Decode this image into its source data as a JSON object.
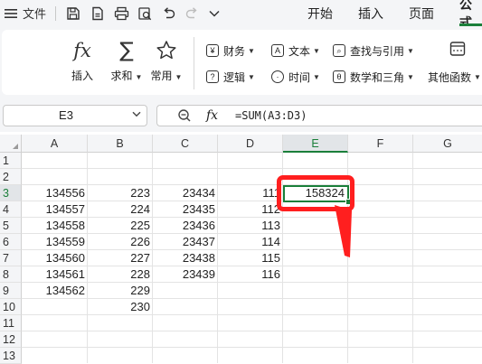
{
  "titlebar": {
    "file_label": "文件",
    "tabs": [
      {
        "label": "开始"
      },
      {
        "label": "插入"
      },
      {
        "label": "页面"
      },
      {
        "label": "公式"
      }
    ],
    "active_tab": "公式",
    "icons": [
      "menu-icon",
      "save-icon",
      "export-pdf-icon",
      "print-icon",
      "print-preview-icon",
      "undo-icon",
      "redo-icon",
      "more-chevron-icon"
    ]
  },
  "ribbon": {
    "insert_function": "插入",
    "autosum": "求和",
    "common": "常用",
    "finance": "财务",
    "text": "文本",
    "lookup": "查找与引用",
    "logic": "逻辑",
    "time": "时间",
    "math": "数学和三角",
    "other": "其他函数"
  },
  "formula_bar": {
    "name_box": "E3",
    "fx_label": "fx",
    "formula": "=SUM(A3:D3)"
  },
  "sheet": {
    "columns": [
      "A",
      "B",
      "C",
      "D",
      "E",
      "F",
      "G"
    ],
    "rows": [
      "1",
      "2",
      "3",
      "4",
      "5",
      "6",
      "7",
      "8",
      "9",
      "10",
      "11",
      "12",
      "13"
    ],
    "active_column": "E",
    "active_row": "3",
    "cells": {
      "A3": "134556",
      "B3": "223",
      "C3": "23434",
      "D3": "111",
      "E3": "158324",
      "A4": "134557",
      "B4": "224",
      "C4": "23435",
      "D4": "112",
      "A5": "134558",
      "B5": "225",
      "C5": "23436",
      "D5": "113",
      "A6": "134559",
      "B6": "226",
      "C6": "23437",
      "D6": "114",
      "A7": "134560",
      "B7": "227",
      "C7": "23438",
      "D7": "115",
      "A8": "134561",
      "B8": "228",
      "C8": "23439",
      "D8": "116",
      "A9": "134562",
      "B9": "229",
      "B10": "230"
    }
  },
  "colors": {
    "accent_green": "#1a7f3a",
    "annotation_red": "#ff1f1f"
  }
}
